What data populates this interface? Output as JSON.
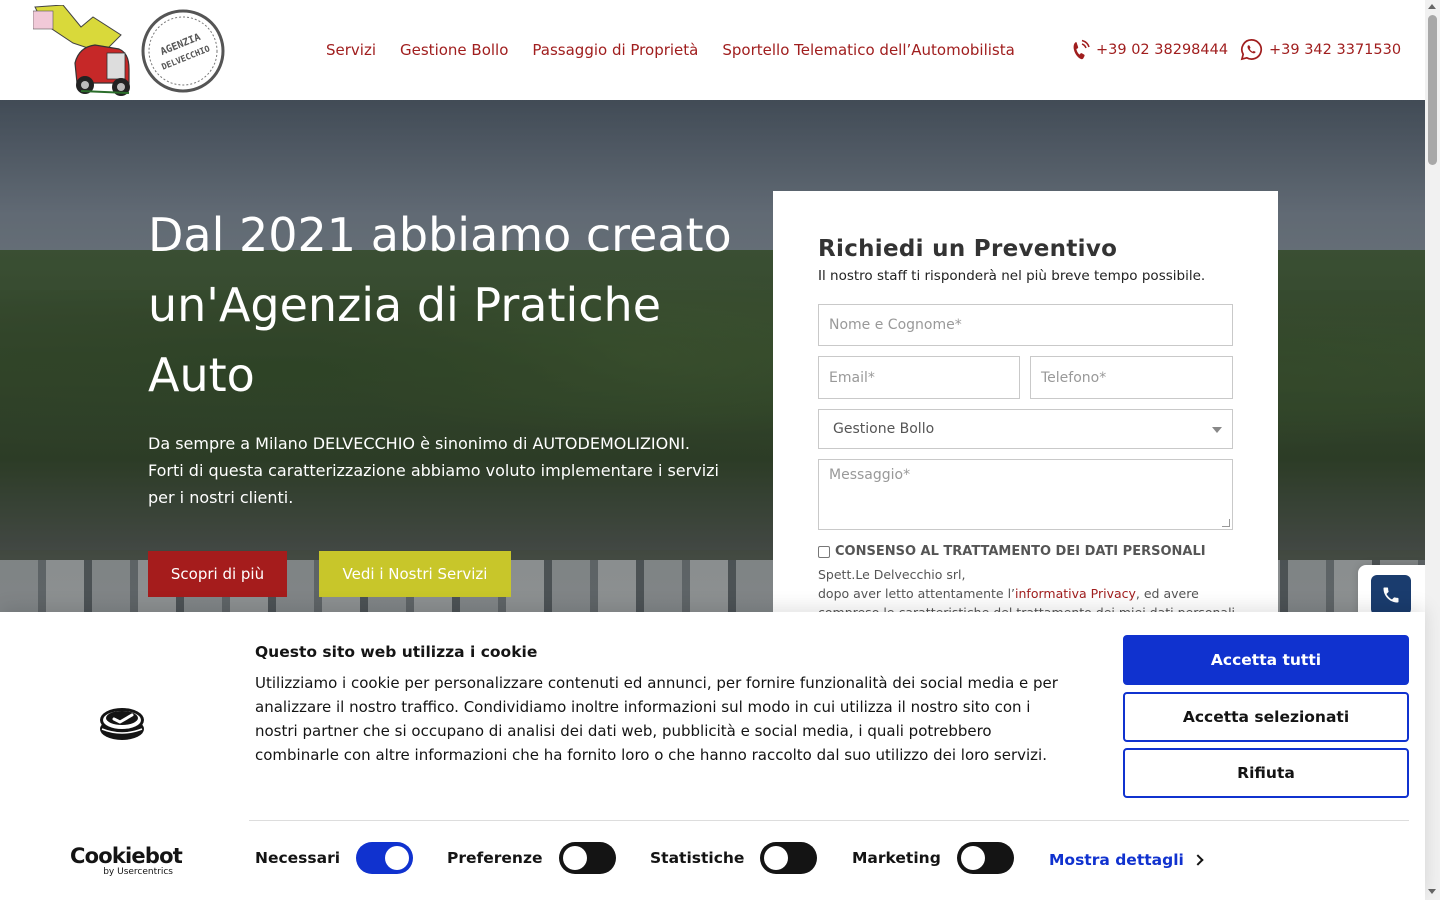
{
  "header": {
    "logo_stamp_text": "AGENZIA DELVECCHIO",
    "nav": [
      {
        "label": "Servizi"
      },
      {
        "label": "Gestione Bollo"
      },
      {
        "label": "Passaggio di Proprietà"
      },
      {
        "label": "Sportello Telematico dell’Automobilista"
      }
    ],
    "phone": "+39 02 38298444",
    "whatsapp": "+39 342 3371530"
  },
  "hero": {
    "title": "Dal 2021 abbiamo creato un'Agenzia di Pratiche Auto",
    "text": "Da sempre a Milano DELVECCHIO è sinonimo di AUTODEMOLIZIONI. Forti di questa caratterizzazione abbiamo voluto implementare i servizi per i nostri clienti.",
    "btn_primary": "Scopri di più",
    "btn_secondary": "Vedi i Nostri Servizi"
  },
  "form": {
    "title": "Richiedi un Preventivo",
    "subtitle": "Il nostro staff ti risponderà nel più breve tempo possibile.",
    "name_placeholder": "Nome e Cognome*",
    "email_placeholder": "Email*",
    "phone_placeholder": "Telefono*",
    "service_selected": "Gestione Bollo",
    "message_placeholder": "Messaggio*",
    "consent_label": "CONSENSO AL TRATTAMENTO DEI DATI PERSONALI",
    "consent_line1": "Spett.Le Delvecchio srl,",
    "consent_line2_pre": "dopo aver letto attentamente l’",
    "consent_link": "informativa Privacy",
    "consent_line2_post": ", ed avere",
    "consent_line3": "compreso le caratteristiche del trattamento dei miei dati personali"
  },
  "cookie": {
    "title": "Questo sito web utilizza i cookie",
    "body": "Utilizziamo i cookie per personalizzare contenuti ed annunci, per fornire funzionalità dei social media e per analizzare il nostro traffico. Condividiamo inoltre informazioni sul modo in cui utilizza il nostro sito con i nostri partner che si occupano di analisi dei dati web, pubblicità e social media, i quali potrebbero combinarle con altre informazioni che ha fornito loro o che hanno raccolto dal suo utilizzo dei loro servizi.",
    "accept_all": "Accetta tutti",
    "accept_selected": "Accetta selezionati",
    "reject": "Rifiuta",
    "brand": "Cookiebot",
    "brand_by": "by Usercentrics",
    "toggles": [
      {
        "label": "Necessari",
        "on": true
      },
      {
        "label": "Preferenze",
        "on": false
      },
      {
        "label": "Statistiche",
        "on": false
      },
      {
        "label": "Marketing",
        "on": false
      }
    ],
    "details": "Mostra dettagli"
  },
  "colors": {
    "brand_red": "#a01e1e",
    "brand_yellow": "#c8c62a",
    "cookie_blue": "#1032cf"
  }
}
